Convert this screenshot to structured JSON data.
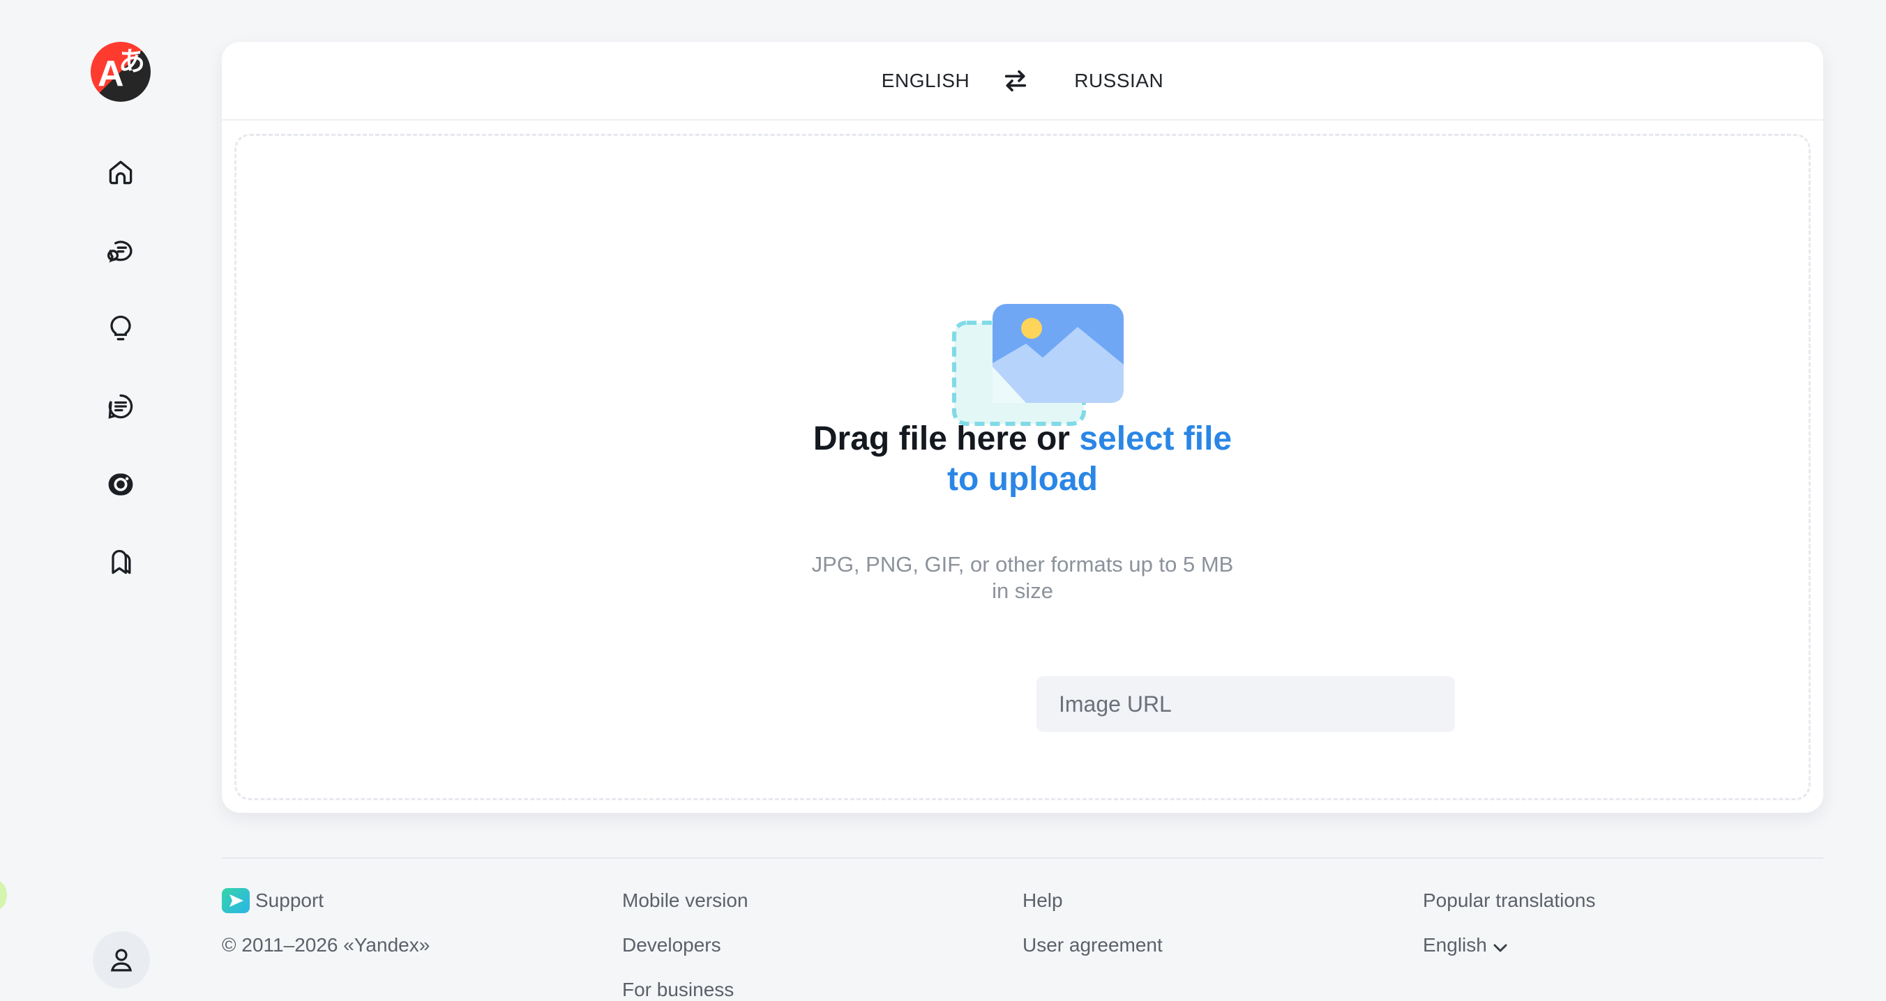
{
  "brand": {
    "logo_icon": "translate-logo",
    "accent": "#ff3b2f",
    "link_color": "#2a86e6"
  },
  "sidebar": {
    "items": [
      {
        "icon": "home-icon",
        "label": "Home"
      },
      {
        "icon": "chat-icon",
        "label": "Dialog"
      },
      {
        "icon": "lightbulb-icon",
        "label": "Ideas"
      },
      {
        "icon": "document-icon",
        "label": "Documents"
      },
      {
        "icon": "camera-icon",
        "label": "Images"
      },
      {
        "icon": "bookmarks-icon",
        "label": "Collections"
      }
    ],
    "user_icon": "user-icon"
  },
  "translator": {
    "source_lang": "ENGLISH",
    "target_lang": "RUSSIAN",
    "swap_icon": "swap-icon"
  },
  "upload": {
    "title_plain": "Drag file here or ",
    "title_link_1": "select file",
    "title_link_2": "to upload",
    "hint_line_1": "JPG, PNG, GIF, or other formats up to 5 MB",
    "hint_line_2": "in size",
    "url_placeholder": "Image URL",
    "url_value": ""
  },
  "footer": {
    "support": "Support",
    "copyright": "© 2011–2026 «Yandex»",
    "mobile": "Mobile version",
    "developers": "Developers",
    "business": "For business",
    "help": "Help",
    "agreement": "User agreement",
    "popular": "Popular translations",
    "ui_language": "English"
  }
}
